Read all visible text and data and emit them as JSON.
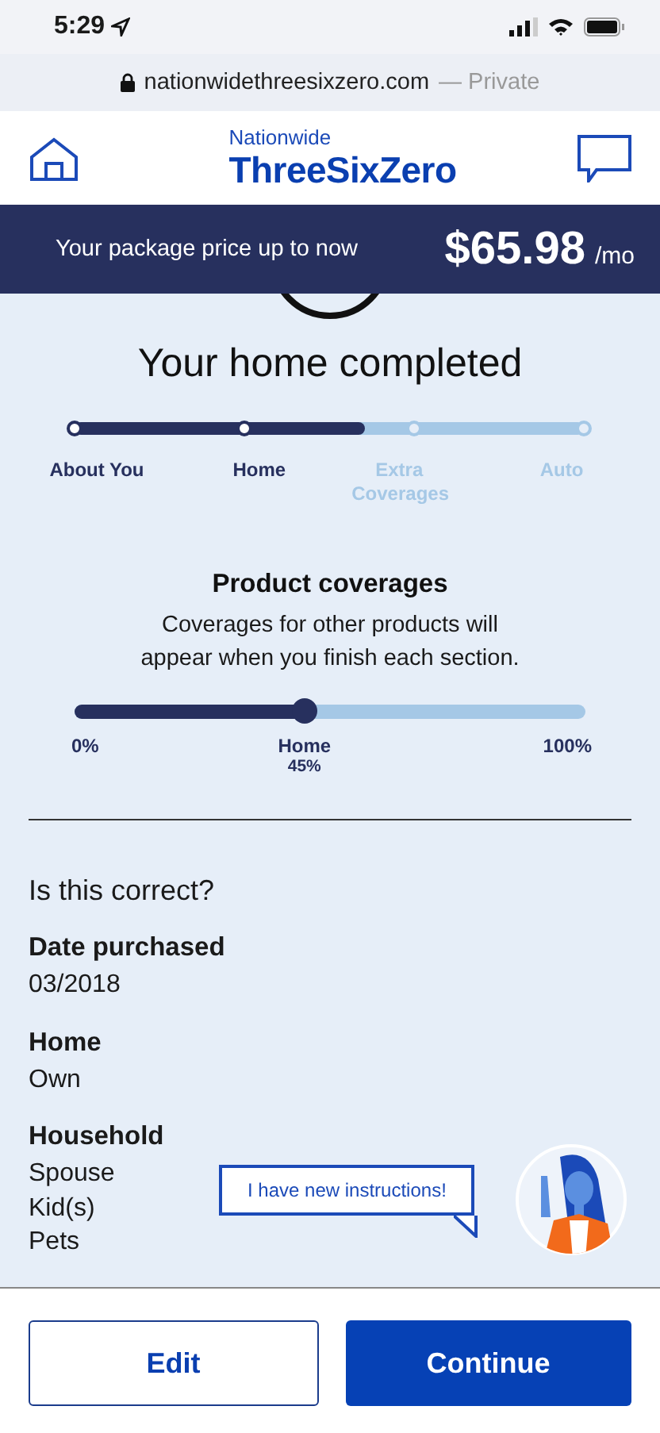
{
  "status_bar": {
    "time": "5:29"
  },
  "browser": {
    "url": "nationwidethreesixzero.com",
    "mode": "— Private"
  },
  "header": {
    "logo_top": "Nationwide",
    "logo_main": "ThreeSixZero"
  },
  "price_bar": {
    "label": "Your package price up to now",
    "price": "$65.98",
    "unit": "/mo"
  },
  "progress": {
    "title": "Your home completed",
    "level": 0.57,
    "steps": [
      {
        "label": "About You",
        "completed": true
      },
      {
        "label": "Home",
        "completed": true
      },
      {
        "label": "Extra Coverages",
        "completed": false
      },
      {
        "label": "Auto",
        "completed": false
      }
    ]
  },
  "coverages": {
    "title": "Product coverages",
    "description": "Coverages for other products will appear when you finish each section.",
    "level": 0.45,
    "start": "0%",
    "marker": "Home",
    "marker_value": "45%",
    "end": "100%"
  },
  "summary": {
    "heading": "Is this correct?",
    "items": [
      {
        "label": "Date purchased",
        "values": [
          "03/2018"
        ]
      },
      {
        "label": "Home",
        "values": [
          "Own"
        ]
      },
      {
        "label": "Household",
        "values": [
          "Spouse",
          "Kid(s)",
          "Pets"
        ]
      }
    ]
  },
  "assistant": {
    "message": "I have new instructions!"
  },
  "buttons": [
    {
      "label": "Edit",
      "kind": "secondary"
    },
    {
      "label": "Continue",
      "kind": "primary"
    }
  ]
}
